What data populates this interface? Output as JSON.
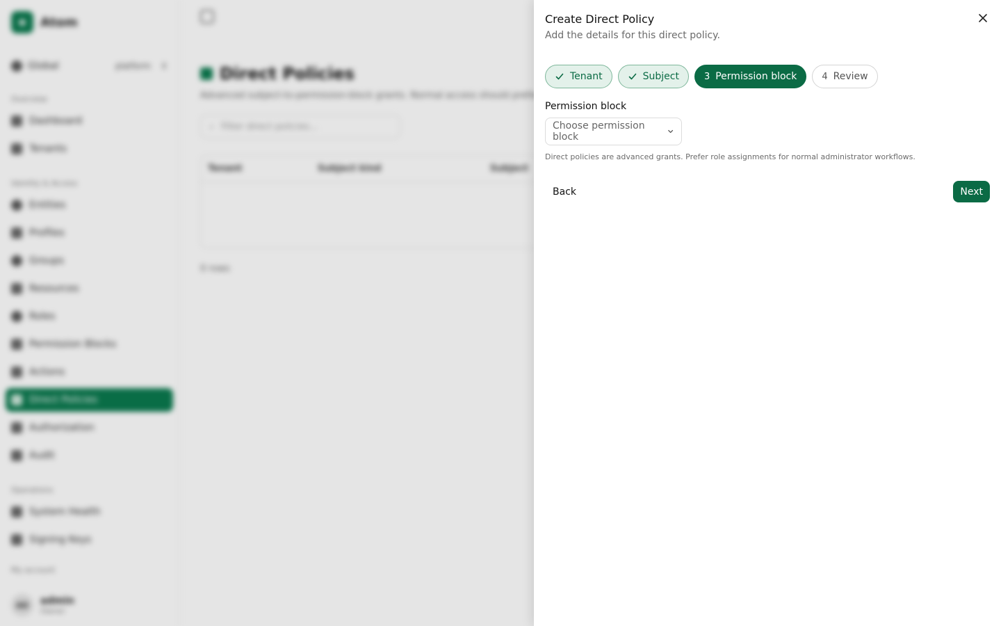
{
  "app": {
    "brand": "Atom",
    "scope": {
      "label": "Global",
      "tenant": "platform"
    },
    "sections": {
      "overview": "Overview",
      "identity": "Identity & Access",
      "operations": "Operations",
      "account": "My account"
    },
    "nav": {
      "dashboard": "Dashboard",
      "tenants": "Tenants",
      "entities": "Entities",
      "profiles": "Profiles",
      "groups": "Groups",
      "resources": "Resources",
      "roles": "Roles",
      "permission_blocks": "Permission Blocks",
      "actions": "Actions",
      "direct_policies": "Direct Policies",
      "authorization": "Authorization",
      "audit": "Audit",
      "system_health": "System Health",
      "signing_keys": "Signing Keys"
    },
    "user": {
      "initials": "AD",
      "name": "admin",
      "role": "Owner"
    },
    "page": {
      "title": "Direct Policies",
      "description": "Advanced subject-to-permission-block grants. Normal access should prefer role assignments.",
      "filter_placeholder": "Filter direct policies...",
      "columns": [
        "Tenant",
        "Subject kind",
        "Subject"
      ],
      "count": "0 rows"
    }
  },
  "sheet": {
    "title": "Create Direct Policy",
    "description": "Add the details for this direct policy.",
    "steps": [
      {
        "label": "Tenant",
        "state": "done"
      },
      {
        "label": "Subject",
        "state": "done"
      },
      {
        "number": "3",
        "label": "Permission block",
        "state": "active"
      },
      {
        "number": "4",
        "label": "Review",
        "state": "pending"
      }
    ],
    "field_label": "Permission block",
    "select_placeholder": "Choose permission block",
    "hint": "Direct policies are advanced grants. Prefer role assignments for normal administrator workflows.",
    "back_label": "Back",
    "next_label": "Next"
  },
  "colors": {
    "accent": "#0b6b45",
    "done_bg": "#e3f1ea"
  }
}
